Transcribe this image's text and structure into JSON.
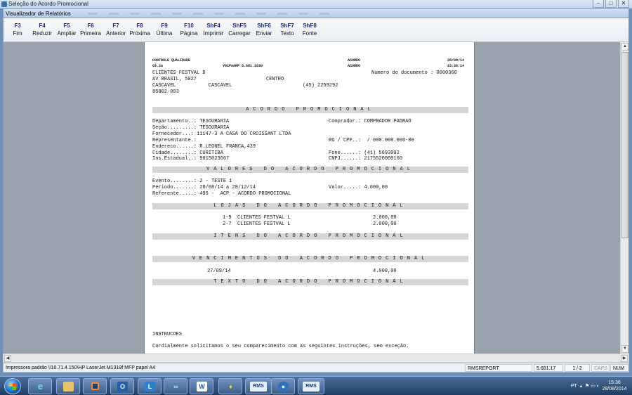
{
  "window": {
    "outer_title": "Seleção do Acordo Promocional",
    "inner_title": "Visualizador de Relatórios",
    "controls": [
      "minimize-icon",
      "maximize-icon",
      "close-icon"
    ]
  },
  "toolbar": [
    {
      "key": "F3",
      "label": "Fim"
    },
    {
      "key": "F4",
      "label": "Reduzir"
    },
    {
      "key": "F5",
      "label": "Ampliar"
    },
    {
      "key": "F6",
      "label": "Primeira"
    },
    {
      "key": "F7",
      "label": "Anterior"
    },
    {
      "key": "F8",
      "label": "Próxima"
    },
    {
      "key": "F9",
      "label": "Última"
    },
    {
      "key": "F10",
      "label": "Página"
    },
    {
      "key": "ShF4",
      "label": "Imprimir"
    },
    {
      "key": "ShF5",
      "label": "Carregar"
    },
    {
      "key": "ShF6",
      "label": "Enviar"
    },
    {
      "key": "ShF7",
      "label": "Texto"
    },
    {
      "key": "ShF8",
      "label": "Fonte"
    }
  ],
  "report": {
    "head_left_1": "CONTROLE QUALIDADE",
    "head_left_2": "03.2a",
    "head_mid": "VGCPAARP 5.681.1030",
    "head_right_1": "ACORDO",
    "head_right_2": "ACORDO",
    "date": "28/08/14",
    "time": "15:36:14",
    "company": "CLIENTES FESTVAL D",
    "address": "AV BRASIL, 5027",
    "district": "CENTRO",
    "city_line": "CASCAVEL           CASCAVEL",
    "phone": "(45) 2259292",
    "cep": "85802-003",
    "doc_number": "Numero do documento : 0000360",
    "title_main": "ACORDO PROMOCIONAL",
    "departamento": "Departamento..: TESOURARIA",
    "secao": "Seção.........: TESOURARIA",
    "fornecedor": "Fornecedor...: 11147-3 A CASA DO CROISSANT LTDA",
    "representante": "Representante.:",
    "endereco": "Endereco......: R.LEONEL FRANCA,439",
    "cidade": "Cidade........: CURITIBA",
    "ins_estadual": "Ins.Estadual..: 9015023667",
    "comprador": "Comprador.: COMPRADOR PADRAO",
    "rg_cpf": "RG / CPF..:  / 000.000.000-00",
    "fone": "Fone......: (41) 5693092",
    "cnpj": "CNPJ......: 2175520000160",
    "title_valores": "VALORES DO ACORDO PROMOCIONAL",
    "evento": "Evento........: 2 - TESTE 1",
    "periodo": "Periodo.......: 28/08/14 a 28/12/14",
    "referente": "Referente.....: 495 -  ACP - ACORDO PROMOCIONAL",
    "valor": "Valor.....: 4.000,00",
    "title_lojas": "LOJAS DO ACORDO PROMOCIONAL",
    "lojas": [
      {
        "name": "1-9  CLIENTES FESTVAL L",
        "value": "2.000,00"
      },
      {
        "name": "2-7  CLIENTES FESTVAL L",
        "value": "2.000,00"
      }
    ],
    "title_itens": "ITENS DO ACORDO PROMOCIONAL",
    "title_vencimentos": "VENCIMENTOS DO ACORDO PROMOCIONAL",
    "venc_date": "27/09/14",
    "venc_value": "4.000,00",
    "title_texto": "TEXTO DO ACORDO PROMOCIONAL",
    "instrucoes": "INSTRUCOES",
    "cordialmente": "Cordialmente solicitamos o seu comparecimento com as seguintes instruções, sem exceção."
  },
  "status": {
    "printer": "Impressora padrão \\\\10.71.4.150\\HP LaserJet M1319f MFP papel A4",
    "report_name": "RMSREPORT",
    "version": "5.681.17",
    "page": "1 / 2",
    "caps": "CAPS",
    "num": "NUM"
  },
  "taskbar": {
    "apps": [
      "ie-icon",
      "explorer-icon",
      "media-icon",
      "outlook-icon",
      "lync-icon",
      "hub-icon",
      "word-icon",
      "cashier-icon",
      "rms-icon",
      "browser-icon",
      "rms-icon"
    ],
    "app_labels": {
      "rms": "RMS"
    },
    "lang": "PT",
    "time": "15:36",
    "date": "28/08/2014"
  }
}
